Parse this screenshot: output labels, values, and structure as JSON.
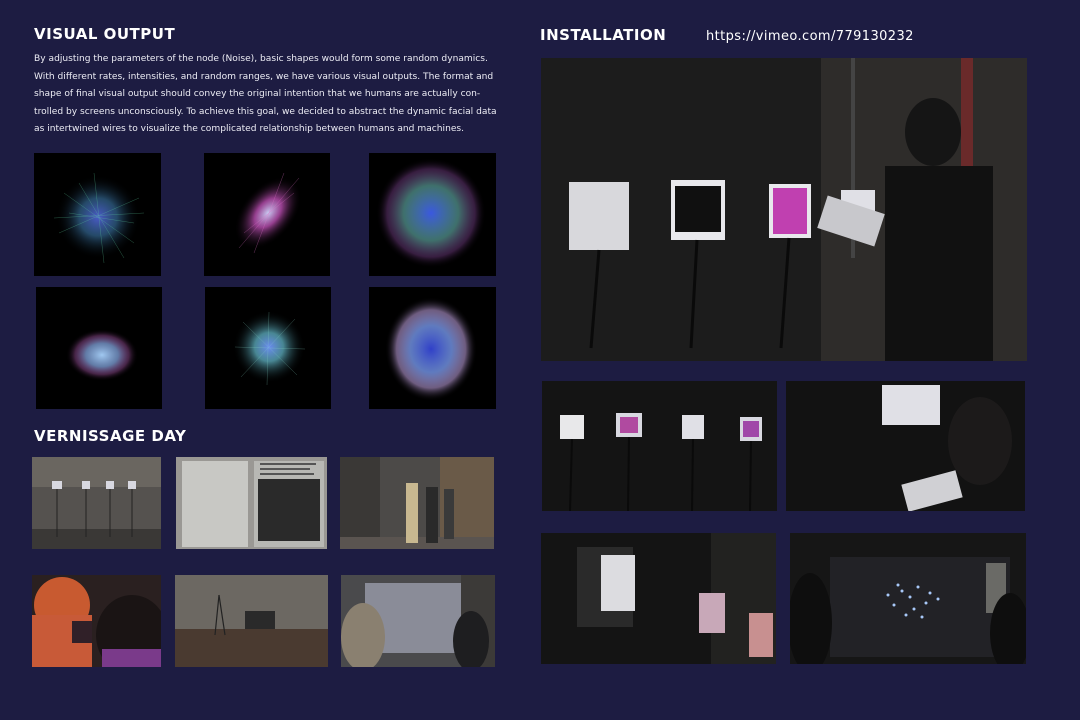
{
  "visual_output": {
    "heading": "VISUAL OUTPUT",
    "paragraph_lines": [
      "By adjusting the parameters of the node (Noise), basic shapes would form some random dynamics.",
      "With different rates, intensities, and random ranges, we have various visual outputs. The format and",
      "shape of final visual output should convey the original intention that we humans are actually con-",
      "trolled by screens unconsciously. To achieve this goal, we decided to abstract the dynamic facial data",
      "as intertwined wires to visualize the complicated relationship between humans and machines."
    ]
  },
  "installation": {
    "heading": "INSTALLATION",
    "url": "https://vimeo.com/779130232"
  },
  "vernissage": {
    "heading": "VERNISSAGE DAY"
  },
  "colors": {
    "background": "#1d1c42",
    "text": "#ffffff"
  }
}
